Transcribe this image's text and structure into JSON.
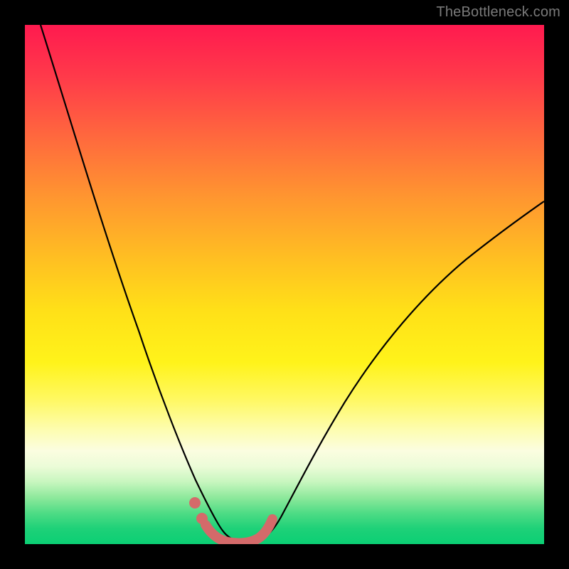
{
  "watermark": "TheBottleneck.com",
  "chart_data": {
    "type": "line",
    "title": "",
    "xlabel": "",
    "ylabel": "",
    "xlim": [
      0,
      1
    ],
    "ylim": [
      0,
      1
    ],
    "background_gradient": {
      "orientation": "vertical",
      "stops": [
        {
          "pos": 0.0,
          "color": "#ff1a4f"
        },
        {
          "pos": 0.22,
          "color": "#ff6a3d"
        },
        {
          "pos": 0.45,
          "color": "#ffbf22"
        },
        {
          "pos": 0.65,
          "color": "#fff31a"
        },
        {
          "pos": 0.82,
          "color": "#fbfde0"
        },
        {
          "pos": 0.91,
          "color": "#8ee99c"
        },
        {
          "pos": 1.0,
          "color": "#0bcf74"
        }
      ]
    },
    "series": [
      {
        "name": "bottleneck-curve",
        "color": "#000000",
        "stroke_width": 2,
        "x": [
          0.03,
          0.08,
          0.14,
          0.2,
          0.26,
          0.3,
          0.33,
          0.35,
          0.37,
          0.39,
          0.41,
          0.43,
          0.45,
          0.48,
          0.52,
          0.58,
          0.66,
          0.76,
          0.88,
          1.0
        ],
        "y": [
          1.0,
          0.8,
          0.58,
          0.4,
          0.24,
          0.15,
          0.1,
          0.07,
          0.05,
          0.04,
          0.04,
          0.05,
          0.07,
          0.12,
          0.2,
          0.32,
          0.46,
          0.58,
          0.66,
          0.71
        ]
      },
      {
        "name": "highlight-left-dots",
        "type": "scatter",
        "color": "#d46a6a",
        "marker_size": 14,
        "x": [
          0.335,
          0.345
        ],
        "y": [
          0.085,
          0.05
        ]
      },
      {
        "name": "highlight-right-segment",
        "color": "#d46a6a",
        "stroke_width": 14,
        "x": [
          0.345,
          0.37,
          0.4,
          0.43,
          0.445,
          0.45
        ],
        "y": [
          0.05,
          0.03,
          0.025,
          0.03,
          0.05,
          0.085
        ]
      }
    ],
    "grid": false,
    "legend": false
  }
}
